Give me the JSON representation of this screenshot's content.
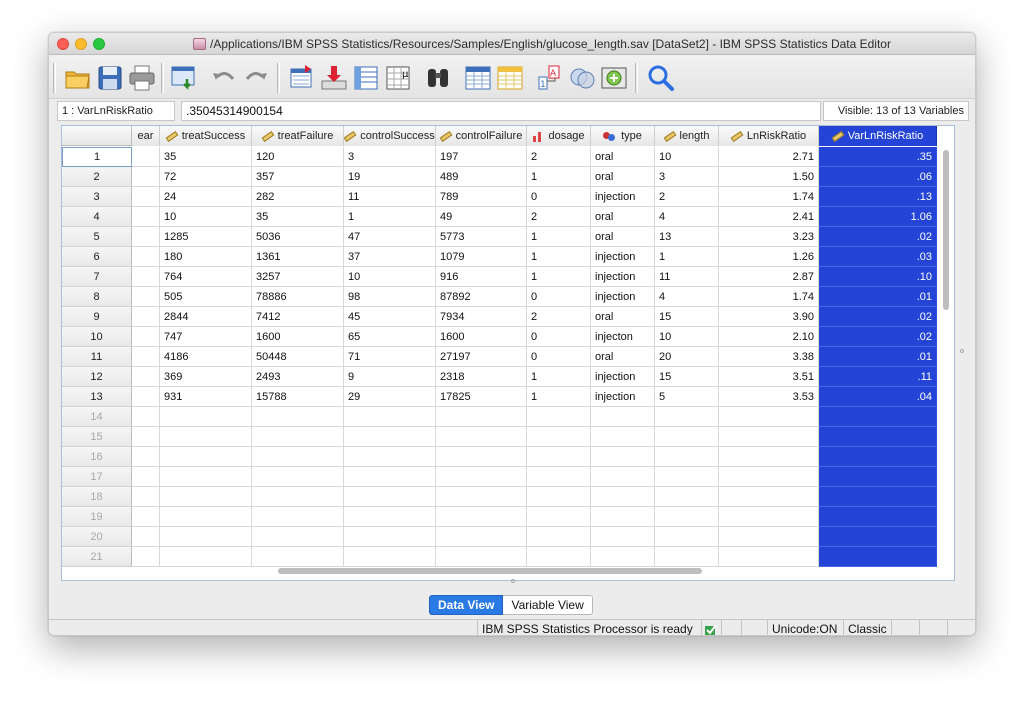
{
  "window": {
    "title": "/Applications/IBM SPSS Statistics/Resources/Samples/English/glucose_length.sav [DataSet2] - IBM SPSS Statistics Data Editor"
  },
  "toolbar": {
    "buttons": [
      {
        "name": "open-icon"
      },
      {
        "name": "save-icon"
      },
      {
        "name": "print-icon"
      },
      {
        "name": "recall-dialog-icon"
      },
      {
        "name": "undo-icon"
      },
      {
        "name": "redo-icon"
      },
      {
        "name": "goto-case-icon"
      },
      {
        "name": "goto-variable-icon"
      },
      {
        "name": "variables-icon"
      },
      {
        "name": "run-descriptives-icon"
      },
      {
        "name": "find-icon"
      },
      {
        "name": "insert-cases-icon"
      },
      {
        "name": "insert-variable-icon"
      },
      {
        "name": "split-file-icon"
      },
      {
        "name": "weight-cases-icon"
      },
      {
        "name": "select-cases-icon"
      },
      {
        "name": "value-labels-icon"
      },
      {
        "name": "search-icon"
      }
    ]
  },
  "cell_editor": {
    "reference": "1 : VarLnRiskRatio",
    "value": ".35045314900154",
    "visible": "Visible: 13 of 13 Variables"
  },
  "grid": {
    "columns": [
      {
        "label": "ear",
        "icon": "none",
        "align": "left",
        "width": 28
      },
      {
        "label": "treatSuccess",
        "icon": "scale-ruler-icon",
        "align": "left",
        "width": 92
      },
      {
        "label": "treatFailure",
        "icon": "scale-ruler-icon",
        "align": "left",
        "width": 92
      },
      {
        "label": "controlSuccess",
        "icon": "scale-ruler-icon",
        "align": "left",
        "width": 92
      },
      {
        "label": "controlFailure",
        "icon": "scale-ruler-icon",
        "align": "left",
        "width": 91
      },
      {
        "label": "dosage",
        "icon": "ordinal-bar-icon",
        "align": "left",
        "width": 64
      },
      {
        "label": "type",
        "icon": "nominal-icon",
        "align": "left",
        "width": 64
      },
      {
        "label": "length",
        "icon": "scale-ruler-icon",
        "align": "left",
        "width": 64
      },
      {
        "label": "LnRiskRatio",
        "icon": "scale-ruler-icon",
        "align": "right",
        "width": 100
      },
      {
        "label": "VarLnRiskRatio",
        "icon": "scale-ruler-icon",
        "align": "right",
        "width": 118,
        "selected": true
      }
    ],
    "row_numbers": [
      "1",
      "2",
      "3",
      "4",
      "5",
      "6",
      "7",
      "8",
      "9",
      "10",
      "11",
      "12",
      "13",
      "14",
      "15",
      "16",
      "17",
      "18",
      "19",
      "20",
      "21"
    ],
    "data_rows": 13,
    "rows": [
      [
        "",
        "35",
        "120",
        "3",
        "197",
        "2",
        "oral",
        "10",
        "2.71",
        ".35"
      ],
      [
        "",
        "72",
        "357",
        "19",
        "489",
        "1",
        "oral",
        "3",
        "1.50",
        ".06"
      ],
      [
        "",
        "24",
        "282",
        "11",
        "789",
        "0",
        "injection",
        "2",
        "1.74",
        ".13"
      ],
      [
        "",
        "10",
        "35",
        "1",
        "49",
        "2",
        "oral",
        "4",
        "2.41",
        "1.06"
      ],
      [
        "",
        "1285",
        "5036",
        "47",
        "5773",
        "1",
        "oral",
        "13",
        "3.23",
        ".02"
      ],
      [
        "",
        "180",
        "1361",
        "37",
        "1079",
        "1",
        "injection",
        "1",
        "1.26",
        ".03"
      ],
      [
        "",
        "764",
        "3257",
        "10",
        "916",
        "1",
        "injection",
        "11",
        "2.87",
        ".10"
      ],
      [
        "",
        "505",
        "78886",
        "98",
        "87892",
        "0",
        "injection",
        "4",
        "1.74",
        ".01"
      ],
      [
        "",
        "2844",
        "7412",
        "45",
        "7934",
        "2",
        "oral",
        "15",
        "3.90",
        ".02"
      ],
      [
        "",
        "747",
        "1600",
        "65",
        "1600",
        "0",
        "injecton",
        "10",
        "2.10",
        ".02"
      ],
      [
        "",
        "4186",
        "50448",
        "71",
        "27197",
        "0",
        "oral",
        "20",
        "3.38",
        ".01"
      ],
      [
        "",
        "369",
        "2493",
        "9",
        "2318",
        "1",
        "injection",
        "15",
        "3.51",
        ".11"
      ],
      [
        "",
        "931",
        "15788",
        "29",
        "17825",
        "1",
        "injection",
        "5",
        "3.53",
        ".04"
      ]
    ]
  },
  "tabs": [
    {
      "label": "Data View",
      "active": true
    },
    {
      "label": "Variable View",
      "active": false
    }
  ],
  "status": {
    "processor": "IBM SPSS Statistics Processor is ready",
    "unicode": "Unicode:ON",
    "mode": "Classic"
  },
  "colors": {
    "selection": "#2344d6",
    "active_tab": "#2a7ae5"
  }
}
